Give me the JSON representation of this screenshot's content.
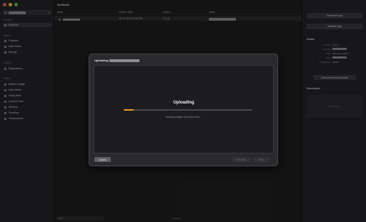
{
  "sidebar": {
    "app_chevron": "⌄",
    "sections": [
      {
        "title": "Reports",
        "items": [
          {
            "label": "Archives",
            "selected": true
          }
        ]
      },
      {
        "title": "Metrics",
        "items": [
          {
            "label": "Crashes"
          },
          {
            "label": "Disk Writes"
          },
          {
            "label": "Energy"
          }
        ]
      },
      {
        "title": "Insights",
        "items": [
          {
            "label": "Regressions"
          }
        ]
      },
      {
        "title": "Metrics",
        "items": [
          {
            "label": "Battery Usage"
          },
          {
            "label": "Disk Writes"
          },
          {
            "label": "Hang Rate"
          },
          {
            "label": "Launch Time"
          },
          {
            "label": "Memory"
          },
          {
            "label": "Scrolling"
          },
          {
            "label": "Terminations"
          }
        ]
      }
    ],
    "filter_placeholder": "Filter"
  },
  "main": {
    "title": "Archives",
    "columns": [
      "Name",
      "Creation Date",
      "Version",
      "Status"
    ],
    "row": {
      "date": "Jul 13, 2022 at 4:09 PM",
      "version": "1.0 (1)"
    },
    "footer": "1 product"
  },
  "right": {
    "distribute_label": "Distribute App",
    "validate_label": "Validate App",
    "details_title": "Details",
    "details": [
      {
        "k": "Version",
        "v": "1.0 (1)"
      },
      {
        "k": "Identifier",
        "v": ""
      },
      {
        "k": "Type",
        "v": "iOS App Archive"
      },
      {
        "k": "Team",
        "v": ""
      },
      {
        "k": "Architecture",
        "v": "arm64"
      }
    ],
    "download_symbols_label": "Download Debug Symbols",
    "description_title": "Description",
    "description_placeholder": "No description"
  },
  "modal": {
    "title_prefix": "Uploading",
    "heading": "Uploading",
    "progress": 0.08,
    "status": "Sending analysis to the App Store...",
    "cancel_label": "Cancel",
    "previous_label": "Previous",
    "next_label": "Next"
  },
  "colors": {
    "progress": "#f09a2a",
    "close": "#ec5f57",
    "minimize": "#f4bf4f",
    "zoom": "#61c454"
  }
}
